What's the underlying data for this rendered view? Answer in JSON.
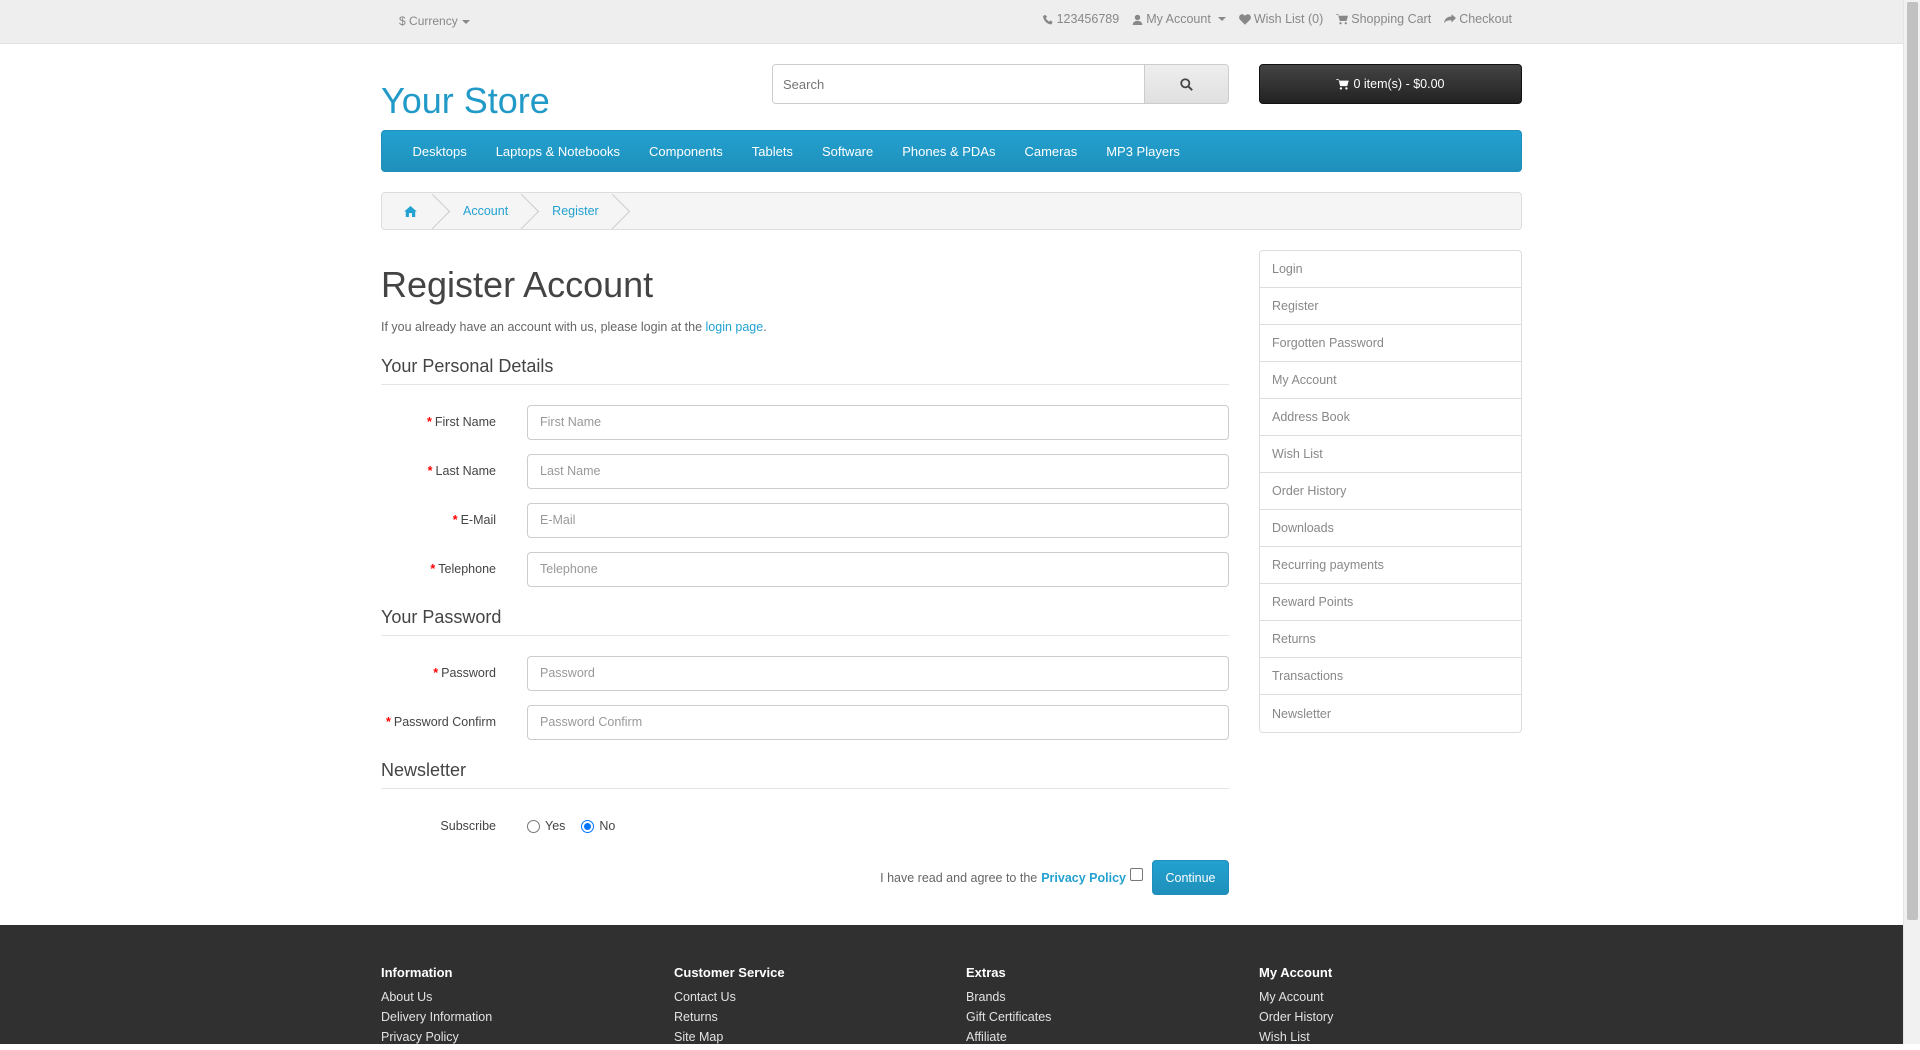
{
  "topbar": {
    "currency_symbol": "$",
    "currency_label": "Currency",
    "phone": "123456789",
    "my_account": "My Account",
    "wishlist": "Wish List (0)",
    "shopping_cart": "Shopping Cart",
    "checkout": "Checkout"
  },
  "header": {
    "logo": "Your Store",
    "search_placeholder": "Search",
    "cart": "0 item(s) - $0.00"
  },
  "menu": [
    "Desktops",
    "Laptops & Notebooks",
    "Components",
    "Tablets",
    "Software",
    "Phones & PDAs",
    "Cameras",
    "MP3 Players"
  ],
  "breadcrumb": [
    "Account",
    "Register"
  ],
  "page": {
    "title": "Register Account",
    "intro_text": "If you already have an account with us, please login at the ",
    "intro_link": "login page",
    "intro_end": "."
  },
  "personal": {
    "legend": "Your Personal Details",
    "fields": [
      {
        "label": "First Name",
        "placeholder": "First Name"
      },
      {
        "label": "Last Name",
        "placeholder": "Last Name"
      },
      {
        "label": "E-Mail",
        "placeholder": "E-Mail"
      },
      {
        "label": "Telephone",
        "placeholder": "Telephone"
      }
    ]
  },
  "password": {
    "legend": "Your Password",
    "fields": [
      {
        "label": "Password",
        "placeholder": "Password"
      },
      {
        "label": "Password Confirm",
        "placeholder": "Password Confirm"
      }
    ]
  },
  "newsletter": {
    "legend": "Newsletter",
    "label": "Subscribe",
    "yes": "Yes",
    "no": "No",
    "selected": "No"
  },
  "agree": {
    "text": "I have read and agree to the",
    "link": "Privacy Policy",
    "button": "Continue"
  },
  "sidebar": [
    "Login",
    "Register",
    "Forgotten Password",
    "My Account",
    "Address Book",
    "Wish List",
    "Order History",
    "Downloads",
    "Recurring payments",
    "Reward Points",
    "Returns",
    "Transactions",
    "Newsletter"
  ],
  "footer": [
    {
      "title": "Information",
      "links": [
        "About Us",
        "Delivery Information",
        "Privacy Policy"
      ]
    },
    {
      "title": "Customer Service",
      "links": [
        "Contact Us",
        "Returns",
        "Site Map"
      ]
    },
    {
      "title": "Extras",
      "links": [
        "Brands",
        "Gift Certificates",
        "Affiliate"
      ]
    },
    {
      "title": "My Account",
      "links": [
        "My Account",
        "Order History",
        "Wish List"
      ]
    }
  ],
  "colors": {
    "accent": "#229ac8",
    "required": "#ff0000",
    "footer_bg": "#303030"
  }
}
